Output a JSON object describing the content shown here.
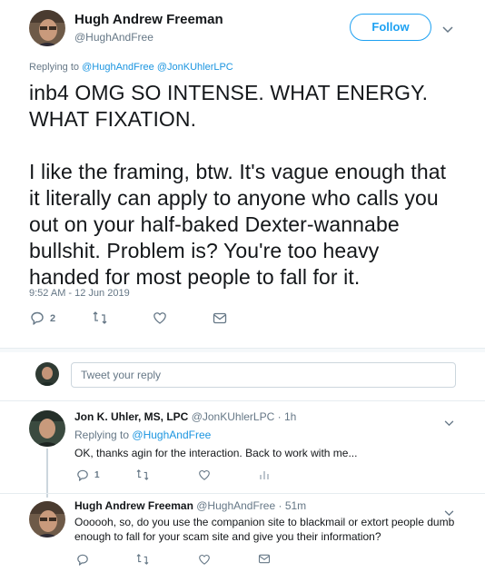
{
  "main_tweet": {
    "author_name": "Hugh Andrew Freeman",
    "author_handle": "@HughAndFree",
    "follow_label": "Follow",
    "replying_prefix": "Replying to",
    "replying_to_1": "@HughAndFree",
    "replying_to_2": "@JonKUhlerLPC",
    "text_lines": [
      "inb4 OMG SO INTENSE. WHAT ENERGY.",
      "WHAT FIXATION.",
      "",
      "I like the framing, btw. It's vague enough that",
      "it literally can apply to anyone who calls you",
      "out on your half-baked Dexter-wannabe",
      "bullshit. Problem is? You're too heavy",
      "handed for most people to fall for it."
    ],
    "timestamp": "9:52 AM - 12 Jun 2019",
    "reply_count": "2"
  },
  "composer": {
    "placeholder": "Tweet your reply"
  },
  "replies": [
    {
      "author_name": "Jon K. Uhler, MS, LPC",
      "author_handle": "@JonKUhlerLPC",
      "time": "· 1h",
      "replying_prefix": "Replying to",
      "replying_to": "@HughAndFree",
      "text": "OK, thanks agin for the interaction. Back to work with me...",
      "reply_count": "1"
    },
    {
      "author_name": "Hugh Andrew Freeman",
      "author_handle": "@HughAndFree",
      "time": "· 51m",
      "text_line_1": "Oooooh, so, do you use the companion site to blackmail or extort people dumb",
      "text_line_2": "enough to fall for your scam site and give you their information?"
    }
  ],
  "colors": {
    "accent": "#1da1f2",
    "link": "#1b95e0",
    "muted": "#657786",
    "divider": "#e6ecf0"
  }
}
